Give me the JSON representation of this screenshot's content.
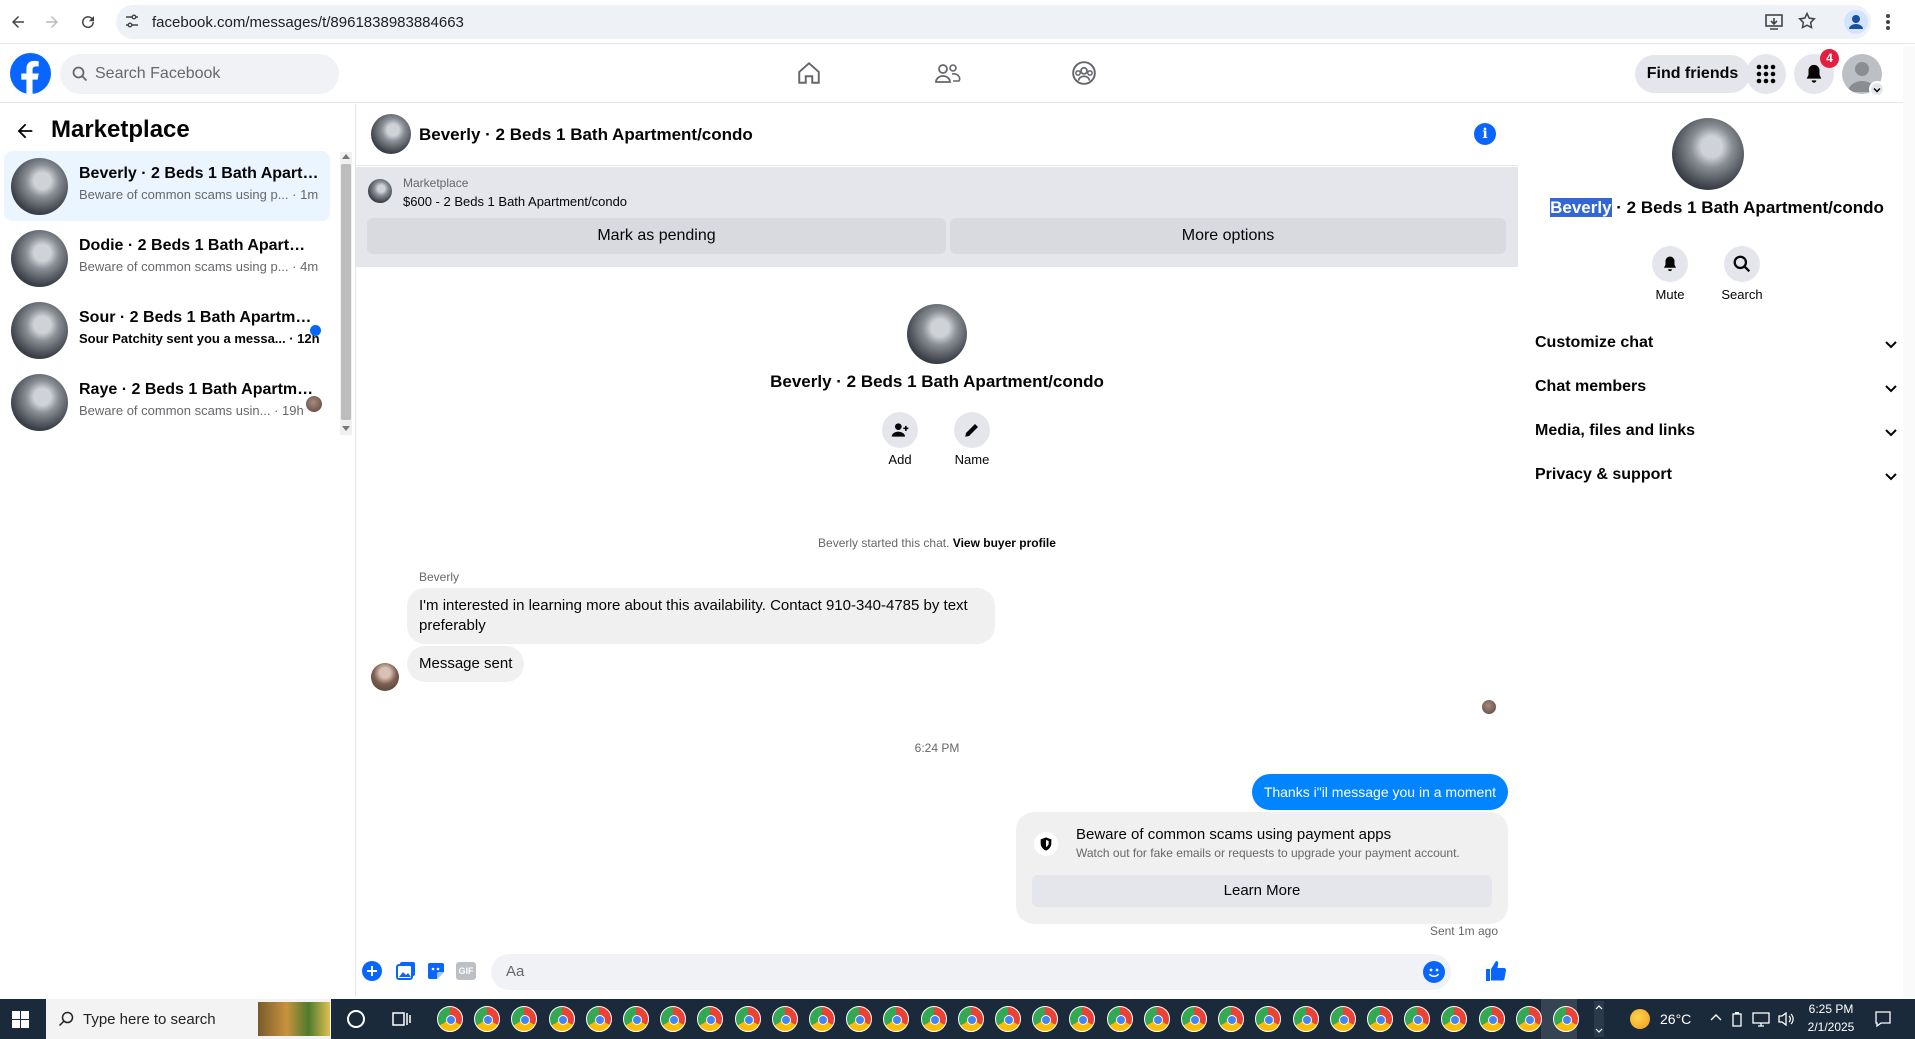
{
  "browser": {
    "url": "facebook.com/messages/t/8961838983884663"
  },
  "fb": {
    "search_placeholder": "Search Facebook",
    "find_friends": "Find friends",
    "notification_count": "4"
  },
  "left": {
    "title": "Marketplace",
    "conversations": [
      {
        "title": "Beverly · 2 Beds 1 Bath Apartme...",
        "preview": "Beware of common scams using p... · 1m"
      },
      {
        "title": "Dodie · 2 Beds 1 Bath Apartmen...",
        "preview": "Beware of common scams using p... · 4m"
      },
      {
        "title": "Sour · 2 Beds 1 Bath Apartmen...",
        "preview": "Sour Patchity sent you a messa... · 12h"
      },
      {
        "title": "Raye · 2 Beds 1 Bath Apartme...",
        "preview": "Beware of common scams usin... · 19h"
      }
    ]
  },
  "chat": {
    "header_title": "Beverly · 2 Beds 1 Bath Apartment/condo",
    "banner_label": "Marketplace",
    "banner_listing": "$600 - 2 Beds 1 Bath Apartment/condo",
    "mark_pending": "Mark as pending",
    "more_options": "More options",
    "intro_title": "Beverly · 2 Beds 1 Bath Apartment/condo",
    "add_label": "Add",
    "name_label": "Name",
    "started_text": "Beverly started this chat.",
    "view_profile": "View buyer profile",
    "sender_name": "Beverly",
    "msg1": "I'm interested in learning more about this availability. Contact 910-340-4785 by text preferably",
    "msg2": "Message sent",
    "time_divider": "6:24 PM",
    "my_msg": "Thanks i\"il message you in a moment",
    "scam_title": "Beware of common scams using payment apps",
    "scam_body": "Watch out for fake emails or requests to upgrade your payment account.",
    "learn_more": "Learn More",
    "sent_status": "Sent 1m ago",
    "input_placeholder": "Aa",
    "gif_label": "GIF"
  },
  "right": {
    "name_highlight": "Beverly",
    "name_rest": " · 2 Beds 1 Bath Apartment/condo",
    "mute": "Mute",
    "search": "Search",
    "sections": [
      "Customize chat",
      "Chat members",
      "Media, files and links",
      "Privacy & support"
    ]
  },
  "taskbar": {
    "search_placeholder": "Type here to search",
    "weather": "26°C",
    "time": "6:25 PM",
    "date": "2/1/2025"
  },
  "colors": {
    "fb_blue": "#0866ff",
    "messenger_blue": "#0084ff",
    "notif_red": "#e41e3f"
  }
}
